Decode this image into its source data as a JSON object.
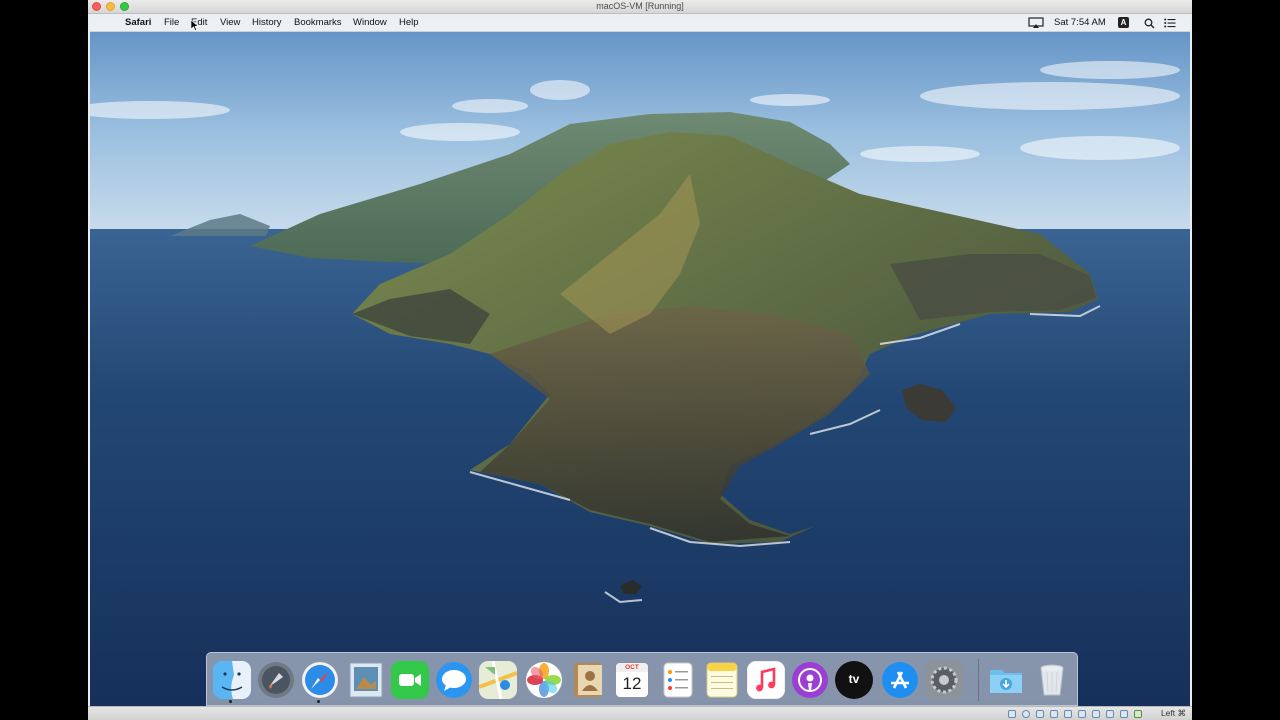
{
  "host": {
    "window_title": "macOS-VM [Running]",
    "host_key_label": "Left ⌘"
  },
  "menubar": {
    "apple_glyph": "",
    "app_name": "Safari",
    "menus": [
      "File",
      "Edit",
      "View",
      "History",
      "Bookmarks",
      "Window",
      "Help"
    ],
    "clock": "Sat 7:54 AM",
    "input_badge": "A"
  },
  "dock": {
    "items": [
      {
        "name": "Finder",
        "running": true
      },
      {
        "name": "Launchpad",
        "running": false
      },
      {
        "name": "Safari",
        "running": true
      },
      {
        "name": "Preview",
        "running": false
      },
      {
        "name": "FaceTime",
        "running": false
      },
      {
        "name": "Messages",
        "running": false
      },
      {
        "name": "Maps",
        "running": false
      },
      {
        "name": "Photos",
        "running": false
      },
      {
        "name": "Contacts",
        "running": false
      },
      {
        "name": "Calendar",
        "running": false,
        "month": "OCT",
        "day": "12"
      },
      {
        "name": "Reminders",
        "running": false
      },
      {
        "name": "Notes",
        "running": false
      },
      {
        "name": "Music",
        "running": false
      },
      {
        "name": "Podcasts",
        "running": false
      },
      {
        "name": "TV",
        "running": false,
        "label": "tv"
      },
      {
        "name": "App Store",
        "running": false
      },
      {
        "name": "System Preferences",
        "running": false
      },
      {
        "name": "Downloads",
        "running": false
      },
      {
        "name": "Trash",
        "running": false
      }
    ]
  },
  "colors": {
    "sea": "#1f3c66",
    "sky": "#8fb7dc",
    "finder_blue": "#2f8fe6",
    "accent_green": "#34c84a"
  }
}
